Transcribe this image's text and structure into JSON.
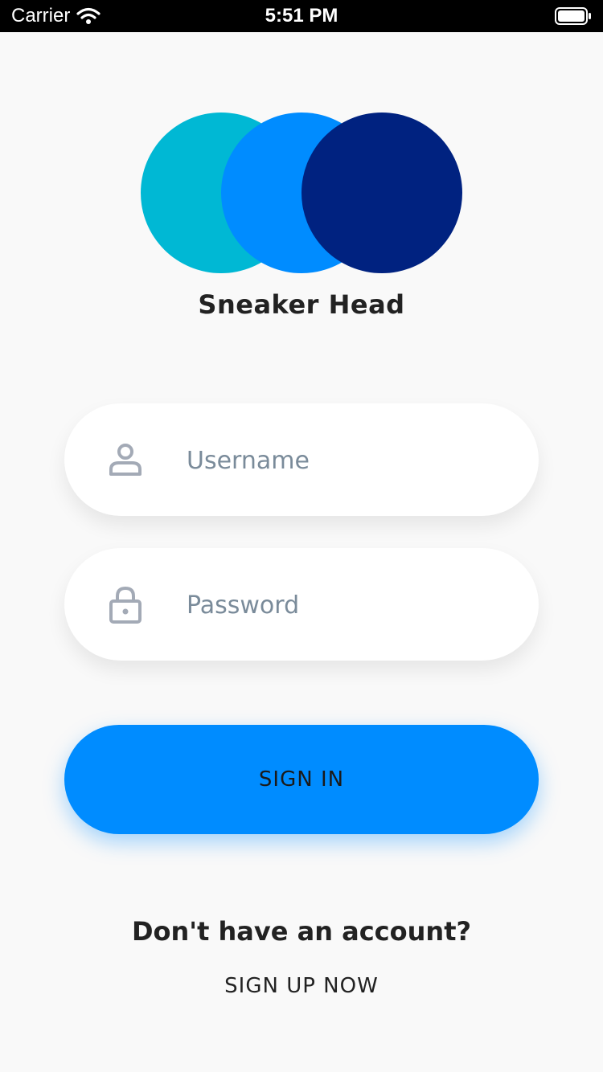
{
  "status_bar": {
    "carrier": "Carrier",
    "time": "5:51 PM"
  },
  "logo": {
    "colors": [
      "#00b8d4",
      "#008cff",
      "#002280"
    ]
  },
  "brand": {
    "name": "Sneaker Head"
  },
  "form": {
    "username": {
      "placeholder": "Username",
      "value": "",
      "icon": "user-icon"
    },
    "password": {
      "placeholder": "Password",
      "value": "",
      "icon": "lock-icon"
    }
  },
  "actions": {
    "signin_label": "SIGN IN",
    "no_account_text": "Don't have an account?",
    "signup_label": "SIGN UP NOW"
  },
  "colors": {
    "accent": "#008cff",
    "background": "#f9f9f9",
    "icon": "#a3aab6"
  }
}
